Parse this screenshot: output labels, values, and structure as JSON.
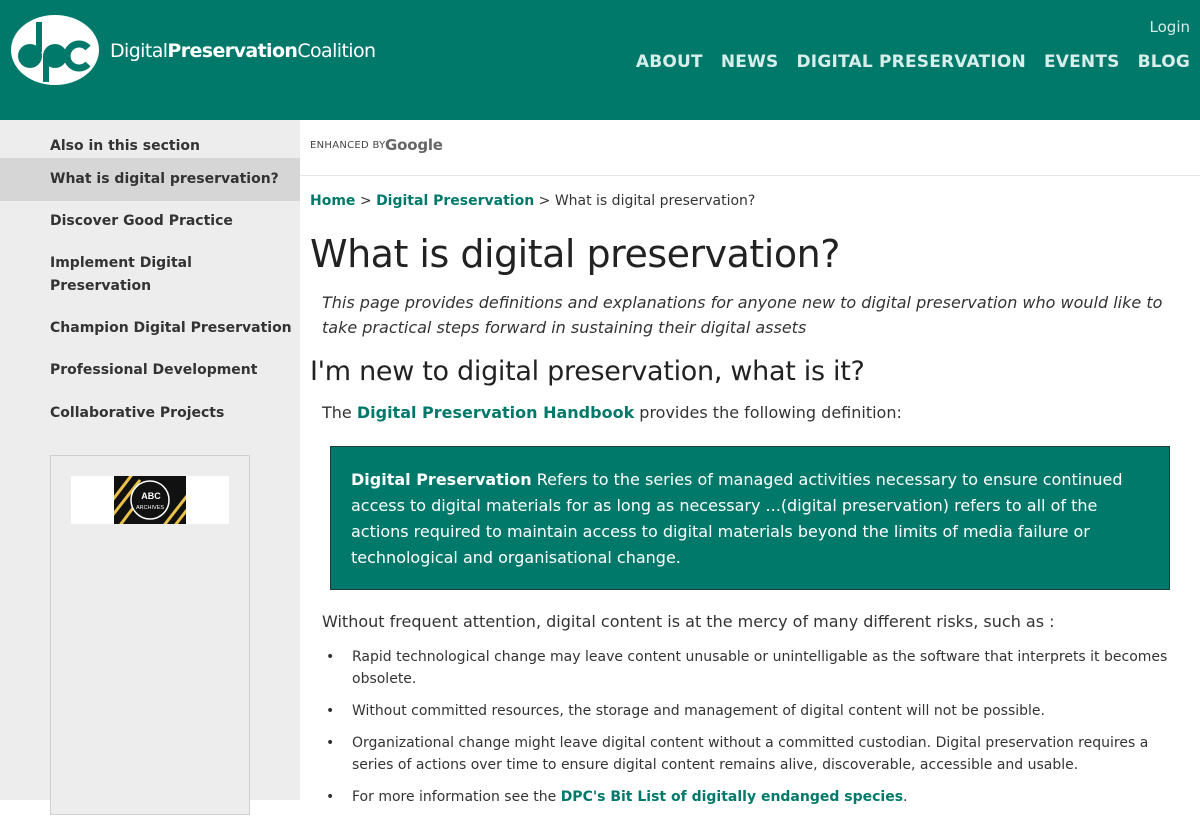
{
  "header": {
    "brand": {
      "part1": "Digital",
      "part2": "Preservation",
      "part3": "Coalition"
    },
    "login_label": "Login",
    "nav": [
      "ABOUT",
      "NEWS",
      "DIGITAL PRESERVATION",
      "EVENTS",
      "BLOG"
    ]
  },
  "sidebar": {
    "heading": "Also in this section",
    "items": [
      {
        "label": "What is digital preservation?"
      },
      {
        "label": "Discover Good Practice"
      },
      {
        "label": "Implement Digital Preservation"
      },
      {
        "label": "Champion Digital Preservation"
      },
      {
        "label": "Professional Development"
      },
      {
        "label": "Collaborative Projects"
      }
    ],
    "promo_text": [
      "ABC",
      "ARCHIVES"
    ]
  },
  "search": {
    "enhanced": "ENHANCED BY",
    "google": "Google"
  },
  "breadcrumb": {
    "home": "Home",
    "sep": ">",
    "section": "Digital Preservation",
    "current": "What is digital preservation?"
  },
  "content": {
    "title": "What is digital preservation?",
    "intro": "This page provides definitions and explanations for anyone new to digital preservation who would like to take practical steps forward in sustaining their digital assets",
    "h2": "I'm new to digital preservation, what is it?",
    "p1_before": "The ",
    "p1_link": "Digital Preservation Handbook",
    "p1_after": " provides the following definition:",
    "def_term": "Digital Preservation",
    "def_text": " Refers to the series of managed activities necessary to ensure continued access to digital materials for as long as necessary  ...(digital preservation) refers to all of the actions required to maintain access to digital materials beyond the limits of media failure or technological and organisational change.",
    "p2": "Without frequent attention, digital content is at the mercy of many different risks, such as :",
    "bullets": [
      "Rapid technological change may leave content unusable or unintelligable as the software that interprets it becomes obsolete.",
      "Without committed resources, the storage and management of digital content will not be possible.",
      "Organizational change might leave digital content without a committed custodian. Digital preservation requires a series of actions over time to ensure digital content remains alive, discoverable, accessible and usable."
    ],
    "bullet4_before": "For more information see the ",
    "bullet4_link": "DPC's Bit List of digitally endanged species",
    "bullet4_after": "."
  },
  "colors": {
    "brand": "#00796b",
    "sidebar_bg": "#ededed",
    "sidebar_active": "#d6d6d6"
  },
  "icons": [
    "dpc-logo",
    "abc-archives-logo"
  ]
}
